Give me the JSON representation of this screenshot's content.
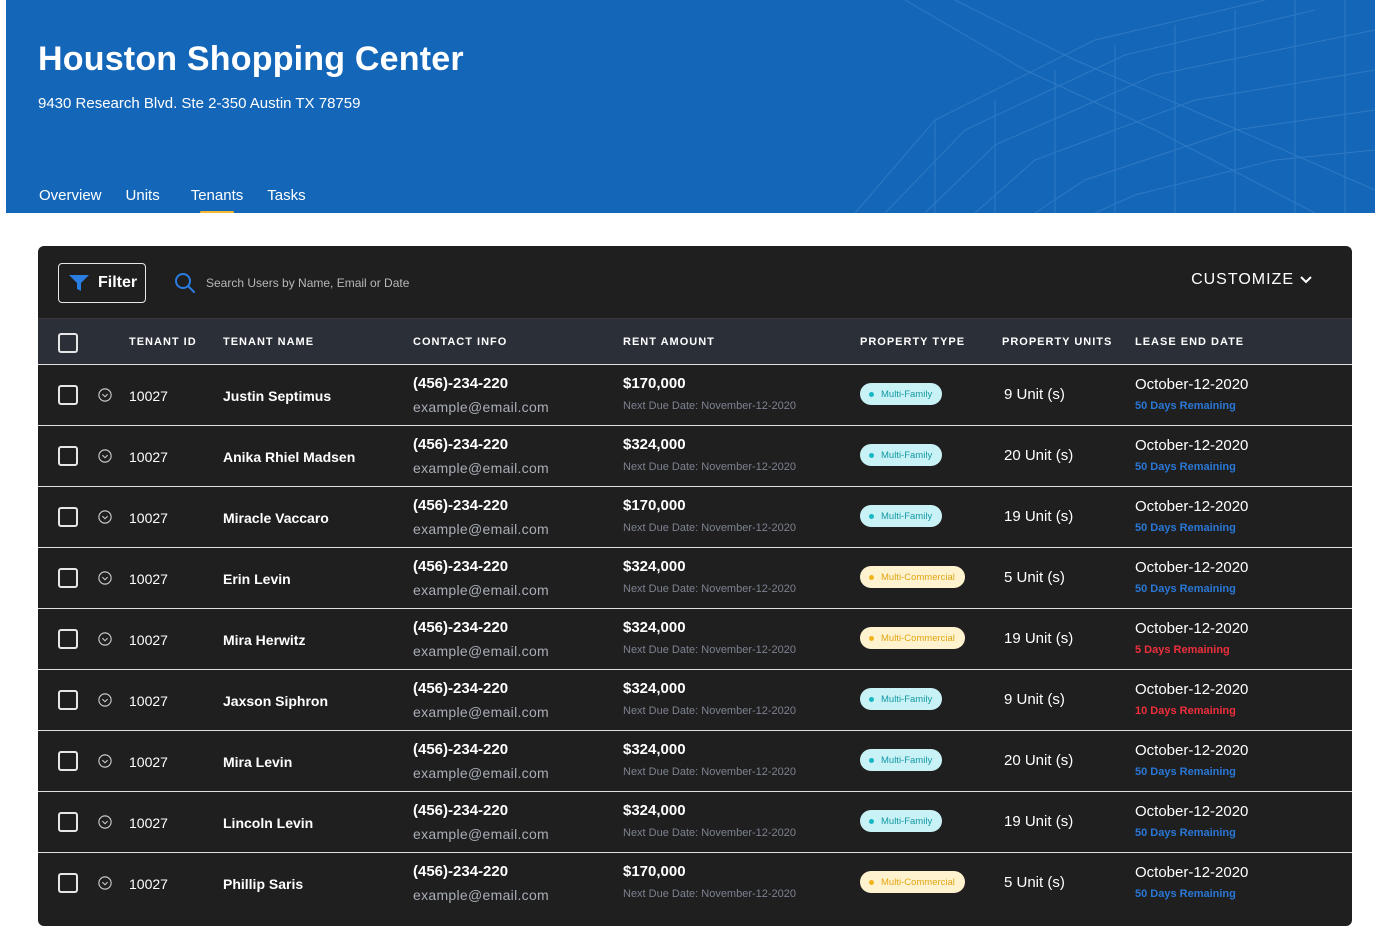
{
  "property": {
    "name": "Houston Shopping Center",
    "address": "9430 Research Blvd. Ste 2-350 Austin TX 78759"
  },
  "tabs": [
    {
      "label": "Overview",
      "active": false
    },
    {
      "label": "Units",
      "active": false
    },
    {
      "label": "Tenants",
      "active": true
    },
    {
      "label": "Tasks",
      "active": false
    }
  ],
  "toolbar": {
    "filter_label": "Filter",
    "search_placeholder": "Search Users by Name, Email or Date",
    "customize_label": "CUSTOMIZE"
  },
  "table": {
    "headers": {
      "tenant_id": "TENANT ID",
      "tenant_name": "TENANT NAME",
      "contact_info": "CONTACT INFO",
      "rent_amount": "RENT AMOUNT",
      "property_type": "PROPERTY TYPE",
      "property_units": "PROPERTY UNITS",
      "lease_end_date": "LEASE END DATE"
    },
    "rows": [
      {
        "id": "10027",
        "name": "Justin Septimus",
        "phone": "(456)-234-220",
        "email": "example@email.com",
        "rent": "$170,000",
        "due": "Next Due Date: November-12-2020",
        "type": "Multi-Family",
        "units": "9 Unit (s)",
        "lease_end": "October-12-2020",
        "remaining": "50 Days Remaining",
        "urgent": false
      },
      {
        "id": "10027",
        "name": "Anika Rhiel Madsen",
        "phone": "(456)-234-220",
        "email": "example@email.com",
        "rent": "$324,000",
        "due": "Next Due Date: November-12-2020",
        "type": "Multi-Family",
        "units": "20 Unit (s)",
        "lease_end": "October-12-2020",
        "remaining": "50 Days Remaining",
        "urgent": false
      },
      {
        "id": "10027",
        "name": "Miracle Vaccaro",
        "phone": "(456)-234-220",
        "email": "example@email.com",
        "rent": "$170,000",
        "due": "Next Due Date: November-12-2020",
        "type": "Multi-Family",
        "units": "19 Unit (s)",
        "lease_end": "October-12-2020",
        "remaining": "50 Days Remaining",
        "urgent": false
      },
      {
        "id": "10027",
        "name": "Erin Levin",
        "phone": "(456)-234-220",
        "email": "example@email.com",
        "rent": "$324,000",
        "due": "Next Due Date: November-12-2020",
        "type": "Multi-Commercial",
        "units": "5 Unit (s)",
        "lease_end": "October-12-2020",
        "remaining": "50 Days Remaining",
        "urgent": false
      },
      {
        "id": "10027",
        "name": "Mira Herwitz",
        "phone": "(456)-234-220",
        "email": "example@email.com",
        "rent": "$324,000",
        "due": "Next Due Date: November-12-2020",
        "type": "Multi-Commercial",
        "units": "19 Unit (s)",
        "lease_end": "October-12-2020",
        "remaining": "5 Days Remaining",
        "urgent": true
      },
      {
        "id": "10027",
        "name": "Jaxson Siphron",
        "phone": "(456)-234-220",
        "email": "example@email.com",
        "rent": "$324,000",
        "due": "Next Due Date: November-12-2020",
        "type": "Multi-Family",
        "units": "9 Unit (s)",
        "lease_end": "October-12-2020",
        "remaining": "10 Days Remaining",
        "urgent": true
      },
      {
        "id": "10027",
        "name": "Mira Levin",
        "phone": "(456)-234-220",
        "email": "example@email.com",
        "rent": "$324,000",
        "due": "Next Due Date: November-12-2020",
        "type": "Multi-Family",
        "units": "20 Unit (s)",
        "lease_end": "October-12-2020",
        "remaining": "50 Days Remaining",
        "urgent": false
      },
      {
        "id": "10027",
        "name": "Lincoln Levin",
        "phone": "(456)-234-220",
        "email": "example@email.com",
        "rent": "$324,000",
        "due": "Next Due Date: November-12-2020",
        "type": "Multi-Family",
        "units": "19 Unit (s)",
        "lease_end": "October-12-2020",
        "remaining": "50 Days Remaining",
        "urgent": false
      },
      {
        "id": "10027",
        "name": "Phillip Saris",
        "phone": "(456)-234-220",
        "email": "example@email.com",
        "rent": "$170,000",
        "due": "Next Due Date: November-12-2020",
        "type": "Multi-Commercial",
        "units": "5 Unit (s)",
        "lease_end": "October-12-2020",
        "remaining": "50 Days Remaining",
        "urgent": false
      }
    ]
  },
  "colors": {
    "hero_bg": "#1466b8",
    "tab_indicator": "#f5b82e",
    "panel_bg": "#1f1f1f",
    "header_bg": "#2b2f37",
    "remaining_normal": "#2a77d6",
    "remaining_urgent": "#ee2f3c",
    "multi_family_badge": "#c8f2f5",
    "multi_commercial_badge": "#fff3cf"
  }
}
